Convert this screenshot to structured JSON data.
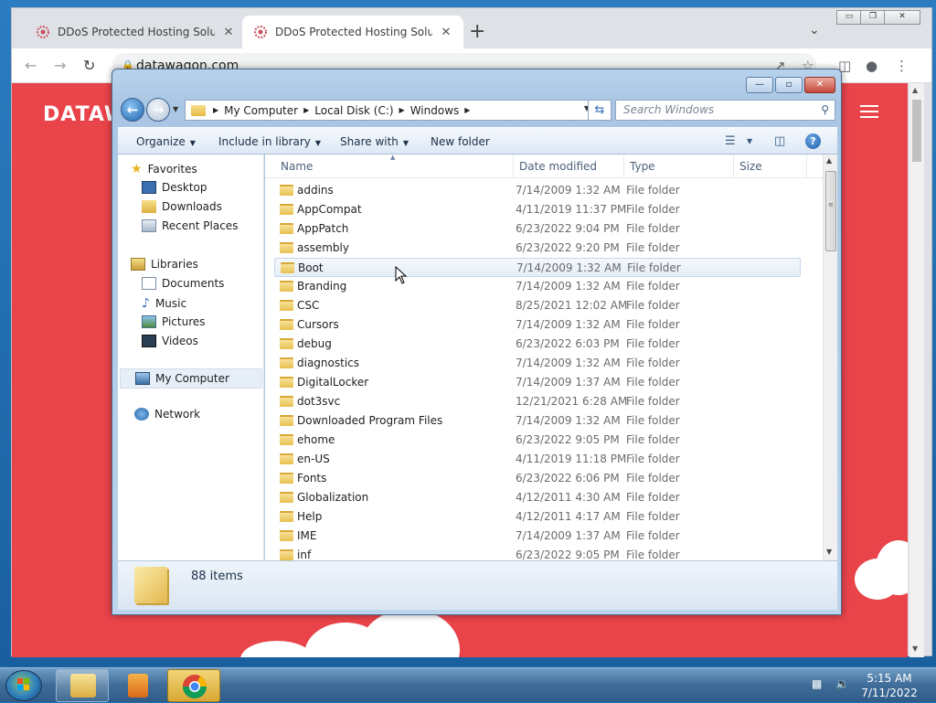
{
  "browser": {
    "tabs": [
      {
        "title": "DDoS Protected Hosting Solution",
        "close": "✕"
      },
      {
        "title": "DDoS Protected Hosting Solution",
        "close": "✕"
      }
    ],
    "new_tab": "+",
    "tab_menu": "⌄",
    "url": "datawagon.com",
    "nav": {
      "back": "←",
      "forward": "→",
      "reload": "↻"
    },
    "window_controls": {
      "minimize": "▭",
      "restore": "❐",
      "close": "✕"
    }
  },
  "site": {
    "logo": "DATAW"
  },
  "explorer": {
    "window_controls": {
      "minimize": "—",
      "restore": "▫",
      "close": "✕"
    },
    "breadcrumb": [
      "My Computer",
      "Local Disk (C:)",
      "Windows"
    ],
    "search_placeholder": "Search Windows",
    "toolbar": {
      "organize": "Organize",
      "include_in_library": "Include in library",
      "share_with": "Share with",
      "new_folder": "New folder"
    },
    "nav_pane": {
      "favorites": "Favorites",
      "favorites_items": [
        "Desktop",
        "Downloads",
        "Recent Places"
      ],
      "libraries": "Libraries",
      "libraries_items": [
        "Documents",
        "Music",
        "Pictures",
        "Videos"
      ],
      "my_computer": "My Computer",
      "network": "Network"
    },
    "columns": {
      "name": "Name",
      "date_modified": "Date modified",
      "type": "Type",
      "size": "Size"
    },
    "files": [
      {
        "name": "addins",
        "date": "7/14/2009 1:32 AM",
        "type": "File folder"
      },
      {
        "name": "AppCompat",
        "date": "4/11/2019 11:37 PM",
        "type": "File folder"
      },
      {
        "name": "AppPatch",
        "date": "6/23/2022 9:04 PM",
        "type": "File folder"
      },
      {
        "name": "assembly",
        "date": "6/23/2022 9:20 PM",
        "type": "File folder"
      },
      {
        "name": "Boot",
        "date": "7/14/2009 1:32 AM",
        "type": "File folder"
      },
      {
        "name": "Branding",
        "date": "7/14/2009 1:32 AM",
        "type": "File folder"
      },
      {
        "name": "CSC",
        "date": "8/25/2021 12:02 AM",
        "type": "File folder"
      },
      {
        "name": "Cursors",
        "date": "7/14/2009 1:32 AM",
        "type": "File folder"
      },
      {
        "name": "debug",
        "date": "6/23/2022 6:03 PM",
        "type": "File folder"
      },
      {
        "name": "diagnostics",
        "date": "7/14/2009 1:32 AM",
        "type": "File folder"
      },
      {
        "name": "DigitalLocker",
        "date": "7/14/2009 1:37 AM",
        "type": "File folder"
      },
      {
        "name": "dot3svc",
        "date": "12/21/2021 6:28 AM",
        "type": "File folder"
      },
      {
        "name": "Downloaded Program Files",
        "date": "7/14/2009 1:32 AM",
        "type": "File folder"
      },
      {
        "name": "ehome",
        "date": "6/23/2022 9:05 PM",
        "type": "File folder"
      },
      {
        "name": "en-US",
        "date": "4/11/2019 11:18 PM",
        "type": "File folder"
      },
      {
        "name": "Fonts",
        "date": "6/23/2022 6:06 PM",
        "type": "File folder"
      },
      {
        "name": "Globalization",
        "date": "4/12/2011 4:30 AM",
        "type": "File folder"
      },
      {
        "name": "Help",
        "date": "4/12/2011 4:17 AM",
        "type": "File folder"
      },
      {
        "name": "IME",
        "date": "7/14/2009 1:37 AM",
        "type": "File folder"
      },
      {
        "name": "inf",
        "date": "6/23/2022 9:05 PM",
        "type": "File folder"
      }
    ],
    "status": "88 items"
  },
  "taskbar": {
    "time": "5:15 AM",
    "date": "7/11/2022"
  }
}
